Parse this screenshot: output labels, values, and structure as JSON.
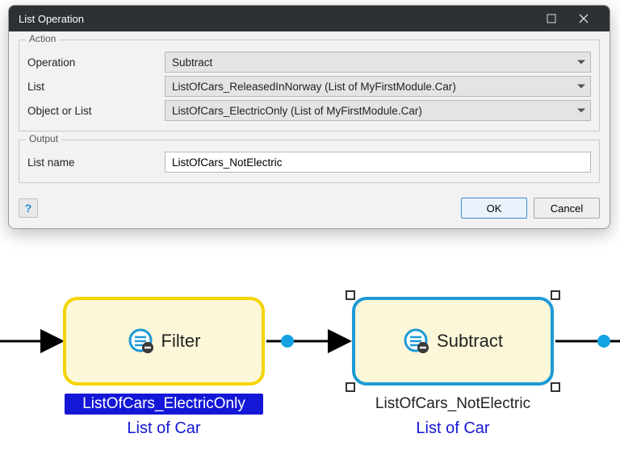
{
  "dialog": {
    "title": "List Operation",
    "groups": {
      "action": {
        "label": "Action",
        "fields": {
          "operation": {
            "label": "Operation",
            "value": "Subtract"
          },
          "list": {
            "label": "List",
            "value": "ListOfCars_ReleasedInNorway (List of MyFirstModule.Car)"
          },
          "objectOrList": {
            "label": "Object or List",
            "value": "ListOfCars_ElectricOnly (List of MyFirstModule.Car)"
          }
        }
      },
      "output": {
        "label": "Output",
        "fields": {
          "listName": {
            "label": "List name",
            "value": "ListOfCars_NotElectric"
          }
        }
      }
    },
    "buttons": {
      "ok": "OK",
      "cancel": "Cancel",
      "help": "?"
    }
  },
  "flow": {
    "nodes": {
      "filter": {
        "title": "Filter",
        "varName": "ListOfCars_ElectricOnly",
        "typeLabel": "List of Car",
        "selected": false
      },
      "subtract": {
        "title": "Subtract",
        "varName": "ListOfCars_NotElectric",
        "typeLabel": "List of Car",
        "selected": true
      }
    }
  }
}
